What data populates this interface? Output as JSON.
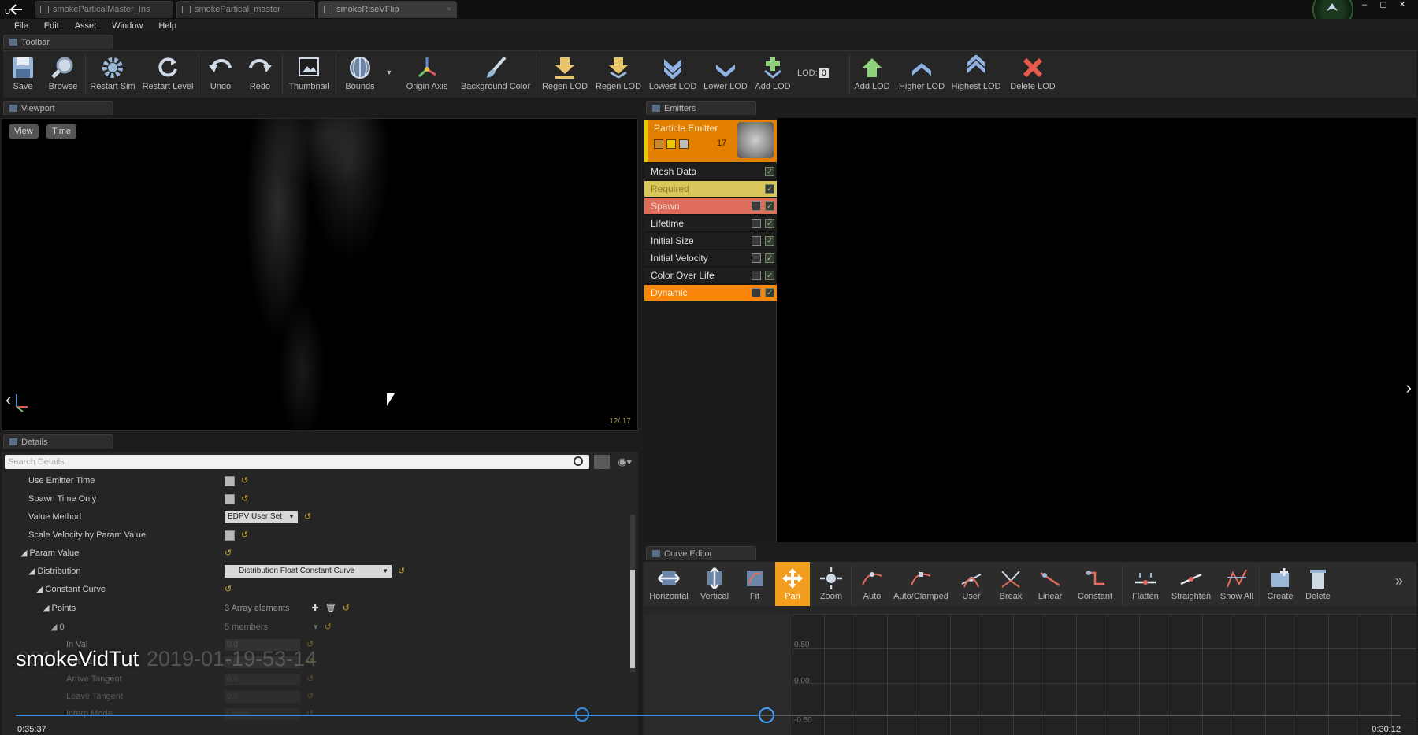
{
  "tabs": [
    "smokeParticalMaster_Ins",
    "smokePartical_master",
    "smokeRiseVFlip"
  ],
  "menu": [
    "File",
    "Edit",
    "Asset",
    "Window",
    "Help"
  ],
  "panels": {
    "toolbar": "Toolbar",
    "viewport": "Viewport",
    "emitters": "Emitters",
    "details": "Details",
    "curve": "Curve Editor"
  },
  "toolbar": [
    "Save",
    "Browse",
    "Restart Sim",
    "Restart Level",
    "Undo",
    "Redo",
    "Thumbnail",
    "Bounds",
    "Origin Axis",
    "Background Color",
    "Regen LOD",
    "Regen LOD",
    "Lowest LOD",
    "Lower LOD",
    "Add LOD",
    "Add LOD",
    "Higher LOD",
    "Highest LOD",
    "Delete LOD"
  ],
  "lod_label": "LOD:",
  "lod_value": "0",
  "viewport": {
    "view": "View",
    "time": "Time",
    "count": "12/ 17"
  },
  "emitter": {
    "name": "Particle Emitter",
    "count": "17"
  },
  "modules": [
    "Mesh Data",
    "Required",
    "Spawn",
    "Lifetime",
    "Initial Size",
    "Initial Velocity",
    "Color Over Life",
    "Dynamic"
  ],
  "details": {
    "search_placeholder": "Search Details",
    "rows": [
      {
        "label": "Use Emitter Time"
      },
      {
        "label": "Spawn Time Only"
      },
      {
        "label": "Value Method",
        "value": "EDPV User Set"
      },
      {
        "label": "Scale Velocity by Param Value"
      },
      {
        "label": "Param Value"
      },
      {
        "label": "Distribution",
        "value": "Distribution Float Constant Curve"
      },
      {
        "label": "Constant Curve"
      },
      {
        "label": "Points",
        "value": "3 Array elements"
      },
      {
        "label": "0",
        "value": "5 members"
      },
      {
        "label": "In Val",
        "value": "0.0"
      },
      {
        "label": "Out Val",
        "value": "0.0"
      },
      {
        "label": "Arrive Tangent",
        "value": "0.0"
      },
      {
        "label": "Leave Tangent",
        "value": "0.0"
      },
      {
        "label": "Interp Mode",
        "value": "Linear"
      }
    ]
  },
  "curve_tools": [
    "Horizontal",
    "Vertical",
    "Fit",
    "Pan",
    "Zoom",
    "Auto",
    "Auto/Clamped",
    "User",
    "Break",
    "Linear",
    "Constant",
    "Flatten",
    "Straighten",
    "Show All",
    "Create",
    "Delete"
  ],
  "curve_labels": [
    "0.50",
    "0.00",
    "-0.50"
  ],
  "video": {
    "title": "smokeVidTut",
    "ghost": "2019-01-19-53-14",
    "elapsed": "0:35:37",
    "remaining": "0:30:12",
    "progress": 0.535
  },
  "colors": {
    "accent": "#f29e1f",
    "emitter": "#e48000",
    "spawn": "#df6b5a",
    "required": "#d9c75c",
    "dynamic": "#f7860a"
  }
}
